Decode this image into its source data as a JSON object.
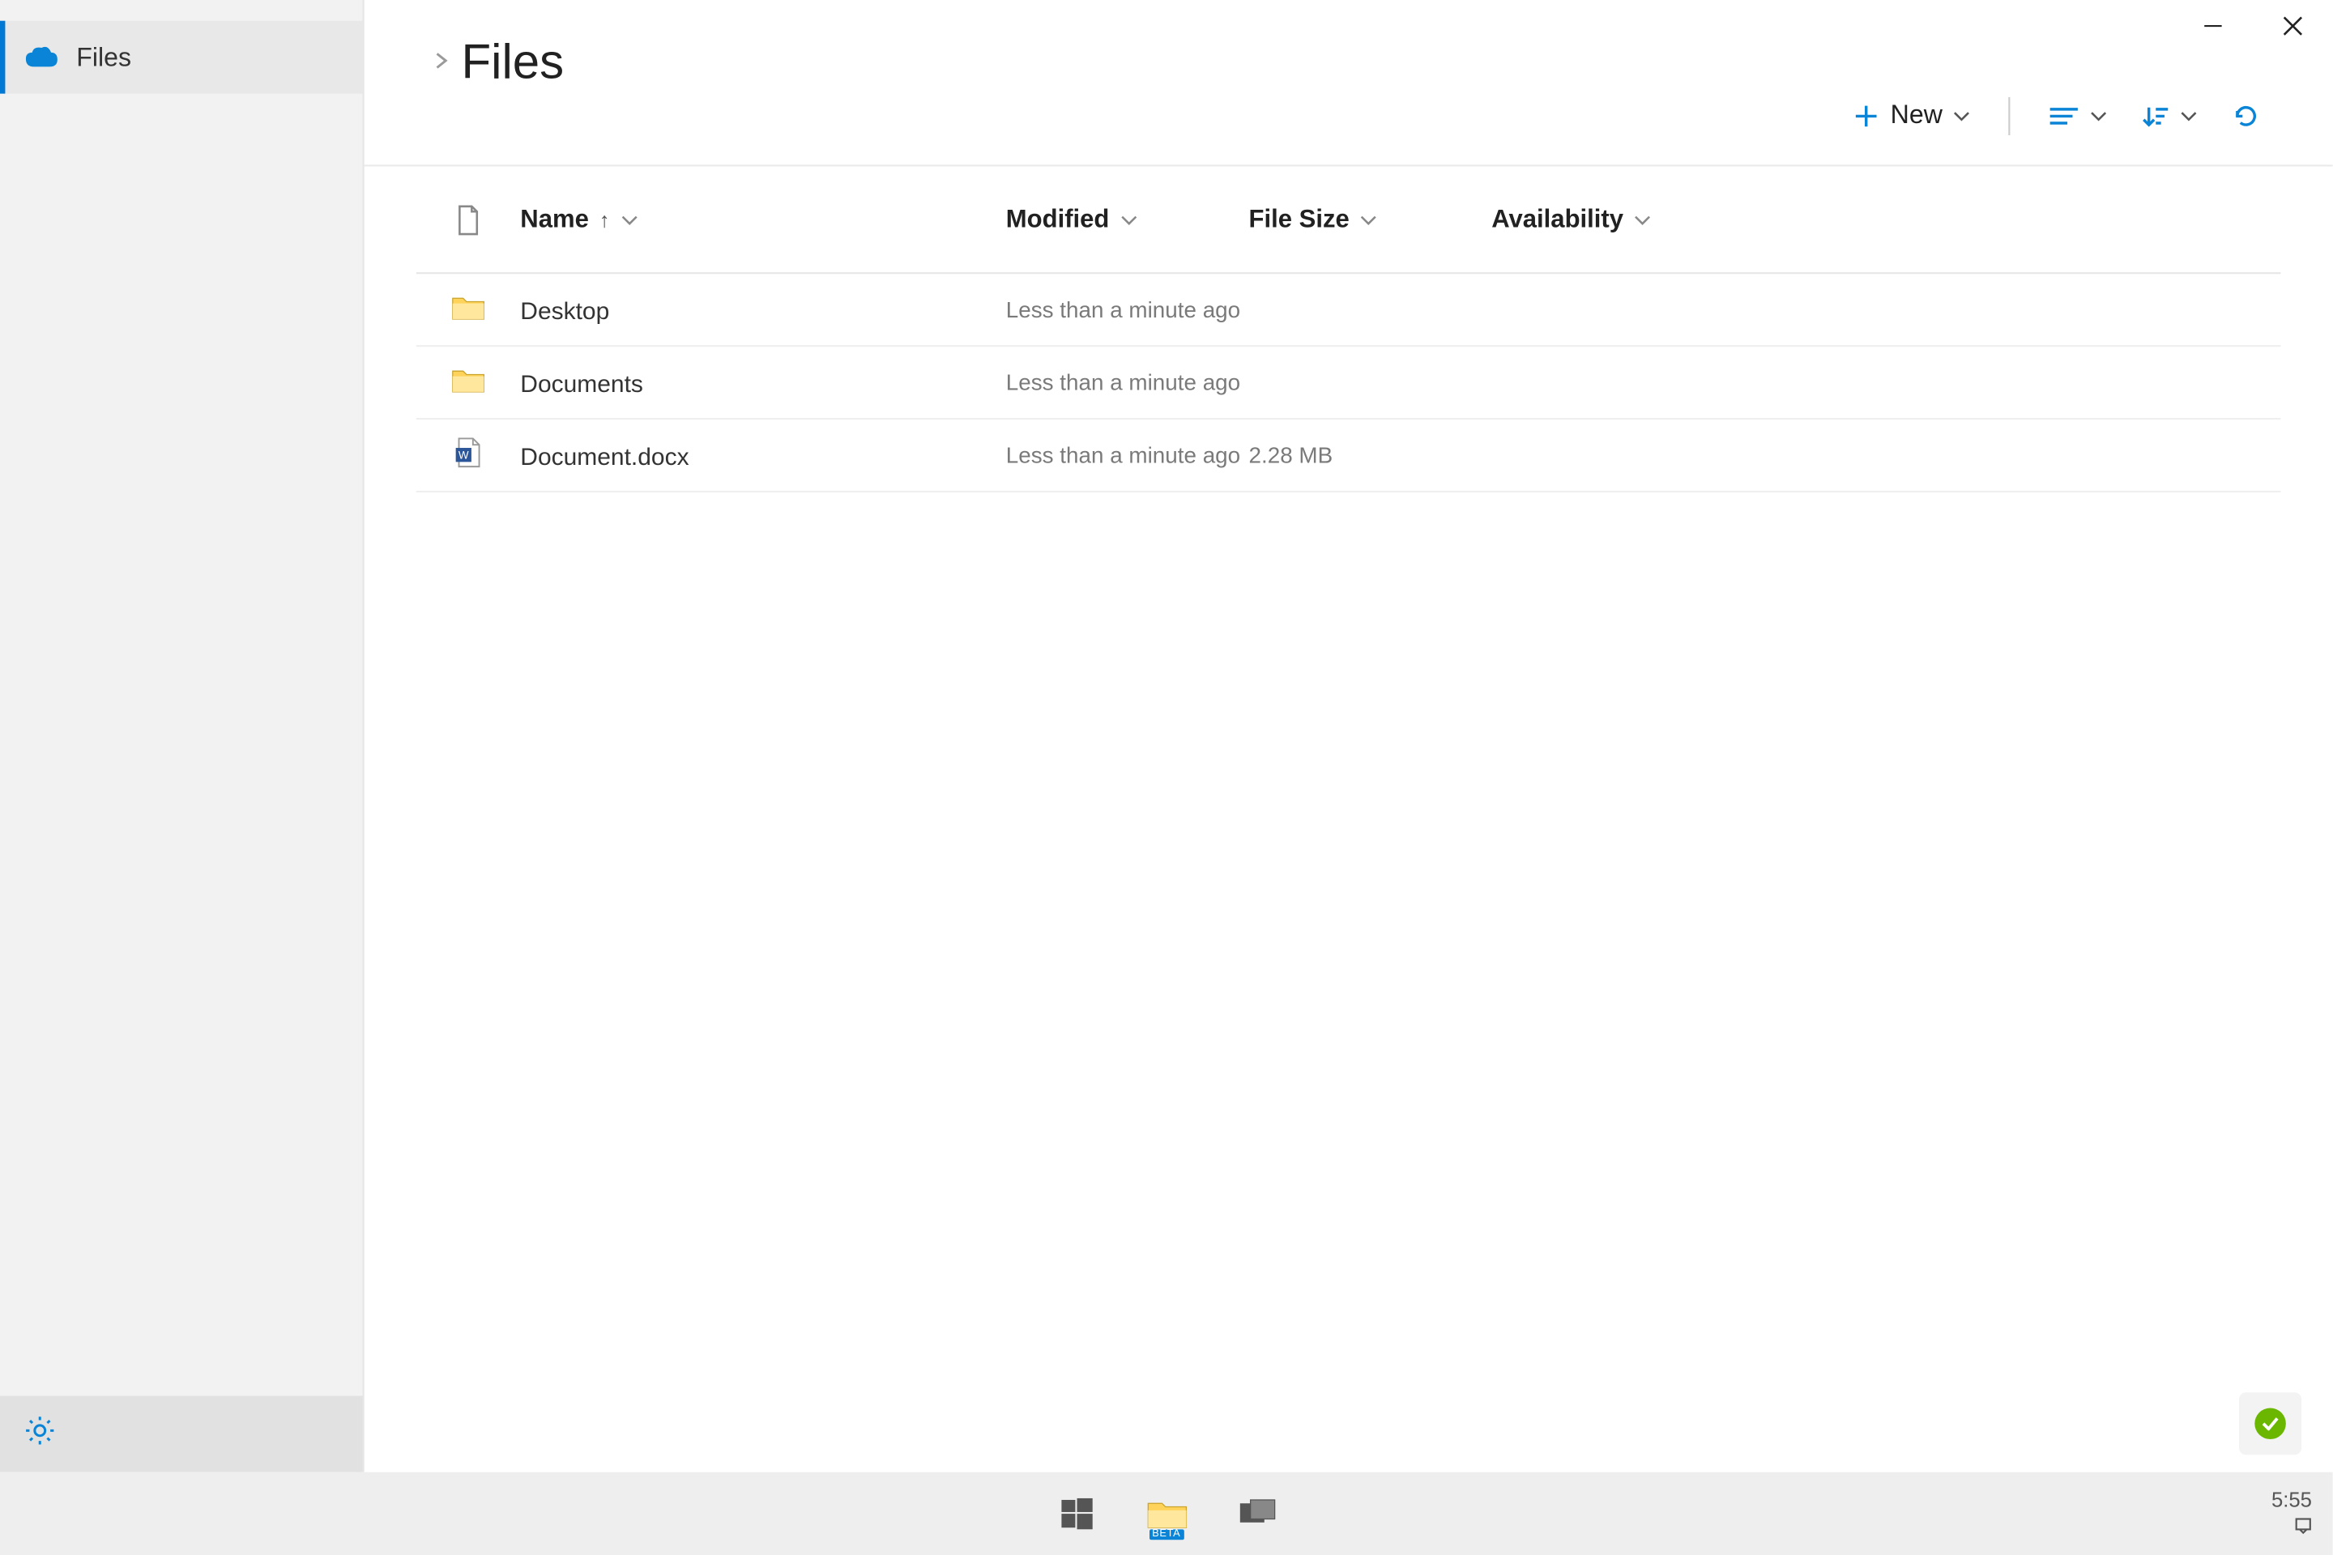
{
  "sidebar": {
    "items": [
      {
        "label": "Files"
      }
    ]
  },
  "header": {
    "title": "Files"
  },
  "toolbar": {
    "new_label": "New"
  },
  "columns": {
    "name": "Name",
    "modified": "Modified",
    "size": "File Size",
    "availability": "Availability"
  },
  "files": [
    {
      "type": "folder",
      "name": "Desktop",
      "modified": "Less than a minute ago",
      "size": "",
      "availability": ""
    },
    {
      "type": "folder",
      "name": "Documents",
      "modified": "Less than a minute ago",
      "size": "",
      "availability": ""
    },
    {
      "type": "docx",
      "name": "Document.docx",
      "modified": "Less than a minute ago",
      "size": "2.28 MB",
      "availability": ""
    }
  ],
  "taskbar": {
    "time": "5:55",
    "beta": "BETA"
  }
}
